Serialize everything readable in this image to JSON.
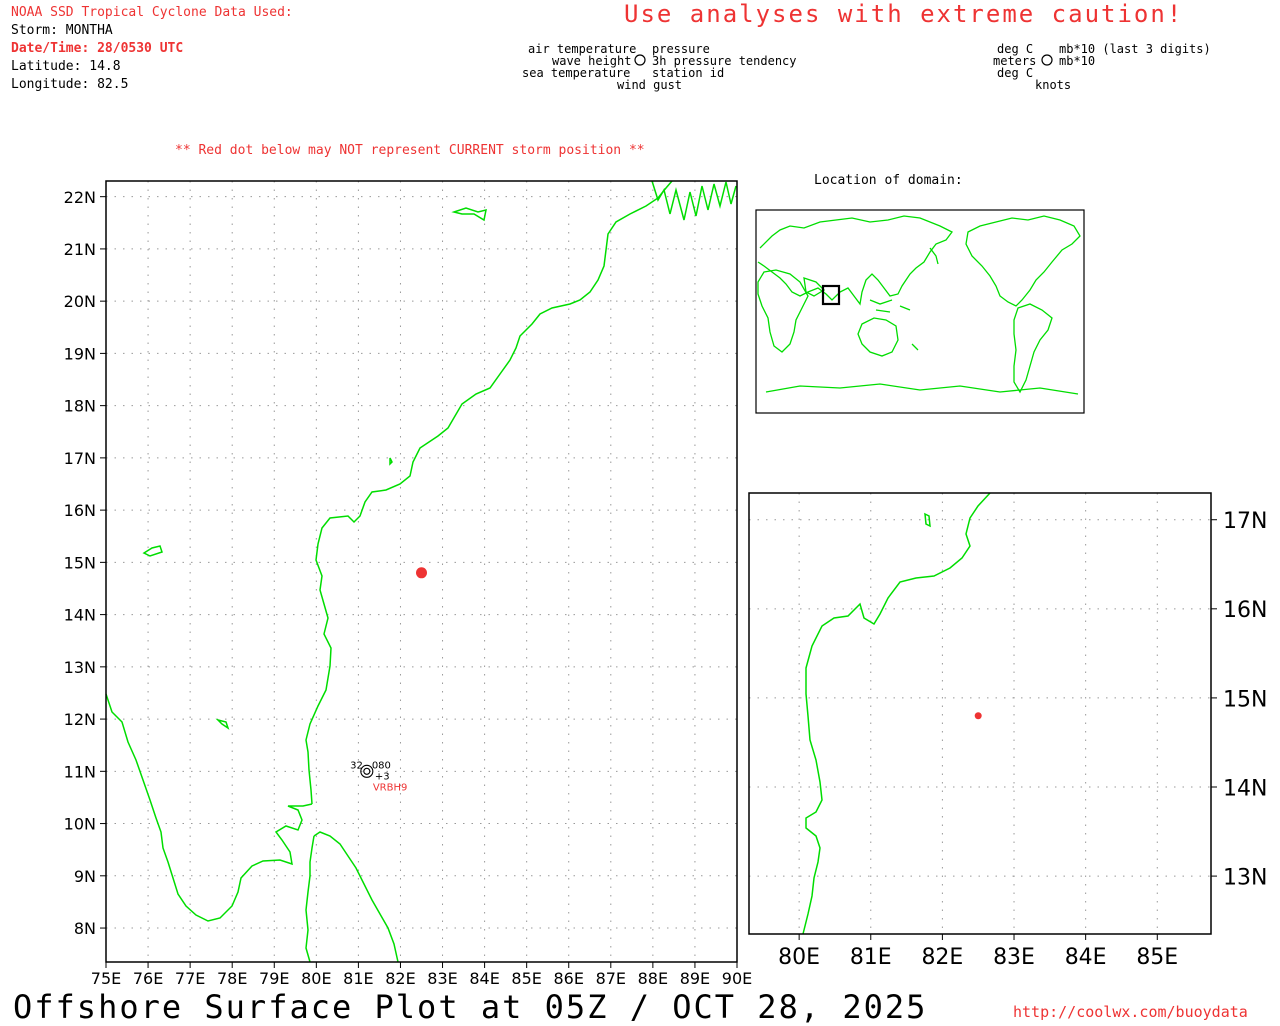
{
  "header": {
    "source": "NOAA SSD Tropical Cyclone Data Used:",
    "storm": "Storm: MONTHA",
    "datetime": "Date/Time: 28/0530 UTC",
    "latitude": "Latitude: 14.8",
    "longitude": "Longitude: 82.5",
    "caution": "Use analyses with extreme caution!"
  },
  "legend": {
    "left": [
      "air temperature",
      "wave height",
      "sea temperature"
    ],
    "right": [
      "pressure",
      "3h pressure tendency",
      "station id"
    ],
    "bottom": "wind gust",
    "units_left": [
      "deg C",
      "meters",
      "deg C"
    ],
    "units_right": [
      "mb*10 (last 3 digits)",
      "mb*10"
    ],
    "units_bottom": "knots"
  },
  "red_dot_note": "** Red dot below may NOT represent CURRENT storm position **",
  "location_label": "Location of domain:",
  "main_map": {
    "lon_range": [
      75,
      90
    ],
    "lat_range": [
      7.35,
      22.3
    ],
    "lon_ticks": [
      "75E",
      "76E",
      "77E",
      "78E",
      "79E",
      "80E",
      "81E",
      "82E",
      "83E",
      "84E",
      "85E",
      "86E",
      "87E",
      "88E",
      "89E",
      "90E"
    ],
    "lat_ticks": [
      "8N",
      "9N",
      "10N",
      "11N",
      "12N",
      "13N",
      "14N",
      "15N",
      "16N",
      "17N",
      "18N",
      "19N",
      "20N",
      "21N",
      "22N"
    ],
    "storm": {
      "lat": 14.8,
      "lon": 82.5
    },
    "station": {
      "id": "VRBH9",
      "lat": 11.0,
      "lon": 81.2,
      "air_temp": "32",
      "pressure": "080",
      "tendency": "+3"
    }
  },
  "zoom_map": {
    "lon_range": [
      79.3,
      85.75
    ],
    "lat_range": [
      12.35,
      17.3
    ],
    "lon_ticks": [
      "80E",
      "81E",
      "82E",
      "83E",
      "84E",
      "85E"
    ],
    "lat_ticks": [
      "13N",
      "14N",
      "15N",
      "16N",
      "17N"
    ]
  },
  "colors": {
    "coast": "#00dd00",
    "storm": "#ee3333",
    "grid": "#999999",
    "text_red": "#ee3333"
  },
  "footer": {
    "title": "Offshore Surface Plot at 05Z / OCT 28, 2025",
    "url": "http://coolwx.com/buoydata"
  }
}
